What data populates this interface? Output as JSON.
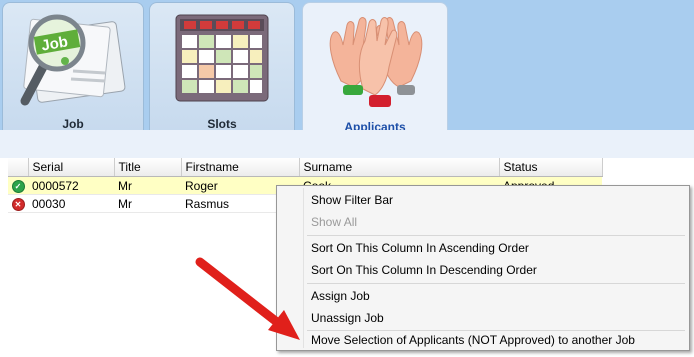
{
  "tabs": [
    {
      "label": "Job",
      "icon": "job-newspaper-icon"
    },
    {
      "label": "Slots",
      "icon": "schedule-grid-icon"
    },
    {
      "label": "Applicants",
      "icon": "raised-hands-icon"
    }
  ],
  "grid": {
    "columns": [
      "Serial",
      "Title",
      "Firstname",
      "Surname",
      "Status"
    ],
    "rows": [
      {
        "status_icon": "approved-check-icon",
        "serial": "0000572",
        "title": "Mr",
        "firstname": "Roger",
        "surname": "Cook",
        "status": "Approved"
      },
      {
        "status_icon": "rejected-x-icon",
        "serial": "00030",
        "title": "Mr",
        "firstname": "Rasmus",
        "surname": "",
        "status": ""
      }
    ]
  },
  "context_menu": {
    "items": [
      {
        "label": "Show Filter Bar",
        "enabled": true
      },
      {
        "label": "Show All",
        "enabled": false
      },
      {
        "label": "Sort On This Column In Ascending Order",
        "enabled": true
      },
      {
        "label": "Sort On This Column In Descending Order",
        "enabled": true
      },
      {
        "label": "Assign Job",
        "enabled": true
      },
      {
        "label": "Unassign Job",
        "enabled": true
      },
      {
        "label": "Move Selection of Applicants (NOT Approved) to another Job",
        "enabled": true
      }
    ]
  },
  "colors": {
    "tab_band": "#a9cdef",
    "active_tab_label": "#1d4fa8",
    "selected_row": "#ffffc4",
    "arrow": "#e0201b"
  }
}
